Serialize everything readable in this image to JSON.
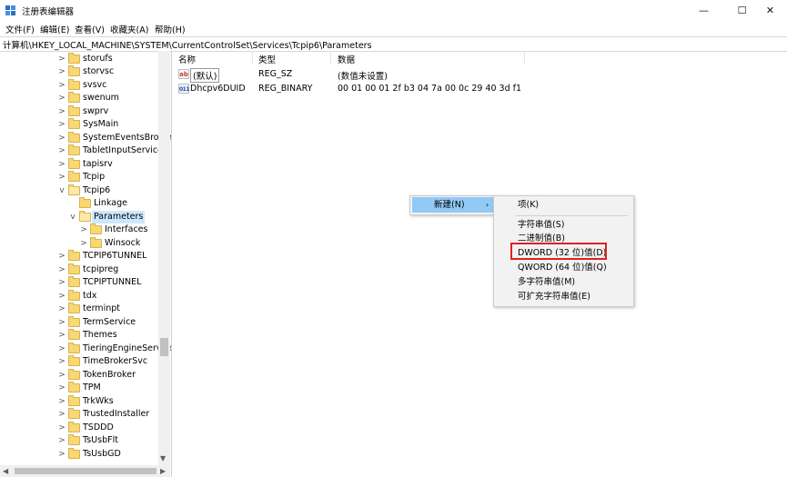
{
  "window": {
    "title": "注册表编辑器",
    "minimize_glyph": "—",
    "maximize_glyph": "☐",
    "close_glyph": "✕"
  },
  "menu": [
    "文件(F)",
    "编辑(E)",
    "查看(V)",
    "收藏夹(A)",
    "帮助(H)"
  ],
  "address": "计算机\\HKEY_LOCAL_MACHINE\\SYSTEM\\CurrentControlSet\\Services\\Tcpip6\\Parameters",
  "tree": {
    "items": [
      {
        "label": "storufs",
        "expander": ">"
      },
      {
        "label": "storvsc",
        "expander": ">"
      },
      {
        "label": "svsvc",
        "expander": ">"
      },
      {
        "label": "swenum",
        "expander": ">"
      },
      {
        "label": "swprv",
        "expander": ">"
      },
      {
        "label": "SysMain",
        "expander": ">"
      },
      {
        "label": "SystemEventsBroker",
        "expander": ">"
      },
      {
        "label": "TabletInputService",
        "expander": ">"
      },
      {
        "label": "tapisrv",
        "expander": ">"
      },
      {
        "label": "Tcpip",
        "expander": ">"
      },
      {
        "label": "Tcpip6",
        "expander": "v"
      },
      {
        "label": "Linkage",
        "expander": ""
      },
      {
        "label": "Parameters",
        "expander": "v"
      },
      {
        "label": "Interfaces",
        "expander": ">"
      },
      {
        "label": "Winsock",
        "expander": ">"
      },
      {
        "label": "TCPIP6TUNNEL",
        "expander": ">"
      },
      {
        "label": "tcpipreg",
        "expander": ">"
      },
      {
        "label": "TCPIPTUNNEL",
        "expander": ">"
      },
      {
        "label": "tdx",
        "expander": ">"
      },
      {
        "label": "terminpt",
        "expander": ">"
      },
      {
        "label": "TermService",
        "expander": ">"
      },
      {
        "label": "Themes",
        "expander": ">"
      },
      {
        "label": "TieringEngineService",
        "expander": ">"
      },
      {
        "label": "TimeBrokerSvc",
        "expander": ">"
      },
      {
        "label": "TokenBroker",
        "expander": ">"
      },
      {
        "label": "TPM",
        "expander": ">"
      },
      {
        "label": "TrkWks",
        "expander": ">"
      },
      {
        "label": "TrustedInstaller",
        "expander": ">"
      },
      {
        "label": "TSDDD",
        "expander": ">"
      },
      {
        "label": "TsUsbFlt",
        "expander": ">"
      },
      {
        "label": "TsUsbGD",
        "expander": ">"
      }
    ]
  },
  "list": {
    "headers": {
      "name": "名称",
      "type": "类型",
      "data": "数据"
    },
    "rows": [
      {
        "icon": "ab",
        "name": "(默认)",
        "type": "REG_SZ",
        "data": "(数值未设置)"
      },
      {
        "icon": "011",
        "name": "Dhcpv6DUID",
        "type": "REG_BINARY",
        "data": "00 01 00 01 2f b3 04 7a 00 0c 29 40 3d f1"
      }
    ]
  },
  "context_menu": {
    "new_label": "新建(N)",
    "arrow": "›"
  },
  "submenu": {
    "items": [
      "项(K)",
      "字符串值(S)",
      "二进制值(B)",
      "DWORD (32 位)值(D)",
      "QWORD (64 位)值(Q)",
      "多字符串值(M)",
      "可扩充字符串值(E)"
    ]
  },
  "colors": {
    "highlight": "#91c9f7",
    "selection": "#cce8ff",
    "annotation_box": "#e02020",
    "folder": "#f8d775"
  }
}
